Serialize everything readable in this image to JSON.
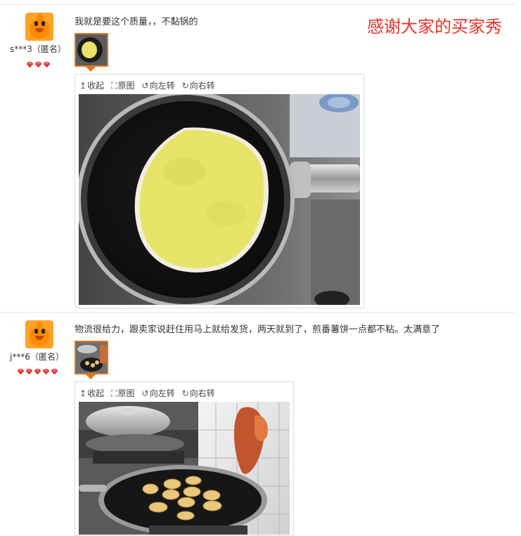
{
  "banner": {
    "text": "感谢大家的买家秀",
    "color": "#e8332a"
  },
  "toolbar": {
    "collapse_label": "收起",
    "original_label": "原图",
    "rotate_left_label": "向左转",
    "rotate_right_label": "向右转",
    "icons": [
      "arrow-up-icon",
      "expand-icon",
      "rotate-left-icon",
      "rotate-right-icon"
    ]
  },
  "accent_color": "#e4741b",
  "reviews": [
    {
      "user": "s***3（匿名）",
      "rank_gems": 3,
      "text": "我就是要这个质量，，不黏锅的",
      "photo_subject": "pancake-in-pan"
    },
    {
      "user": "j***6（匿名）",
      "rank_gems": 5,
      "text": "物流很给力，跟卖家说赶住用马上就给发货，两天就到了，煎番薯饼一点都不粘。太满意了",
      "photo_subject": "sweet-potato-cakes-in-pan"
    }
  ]
}
